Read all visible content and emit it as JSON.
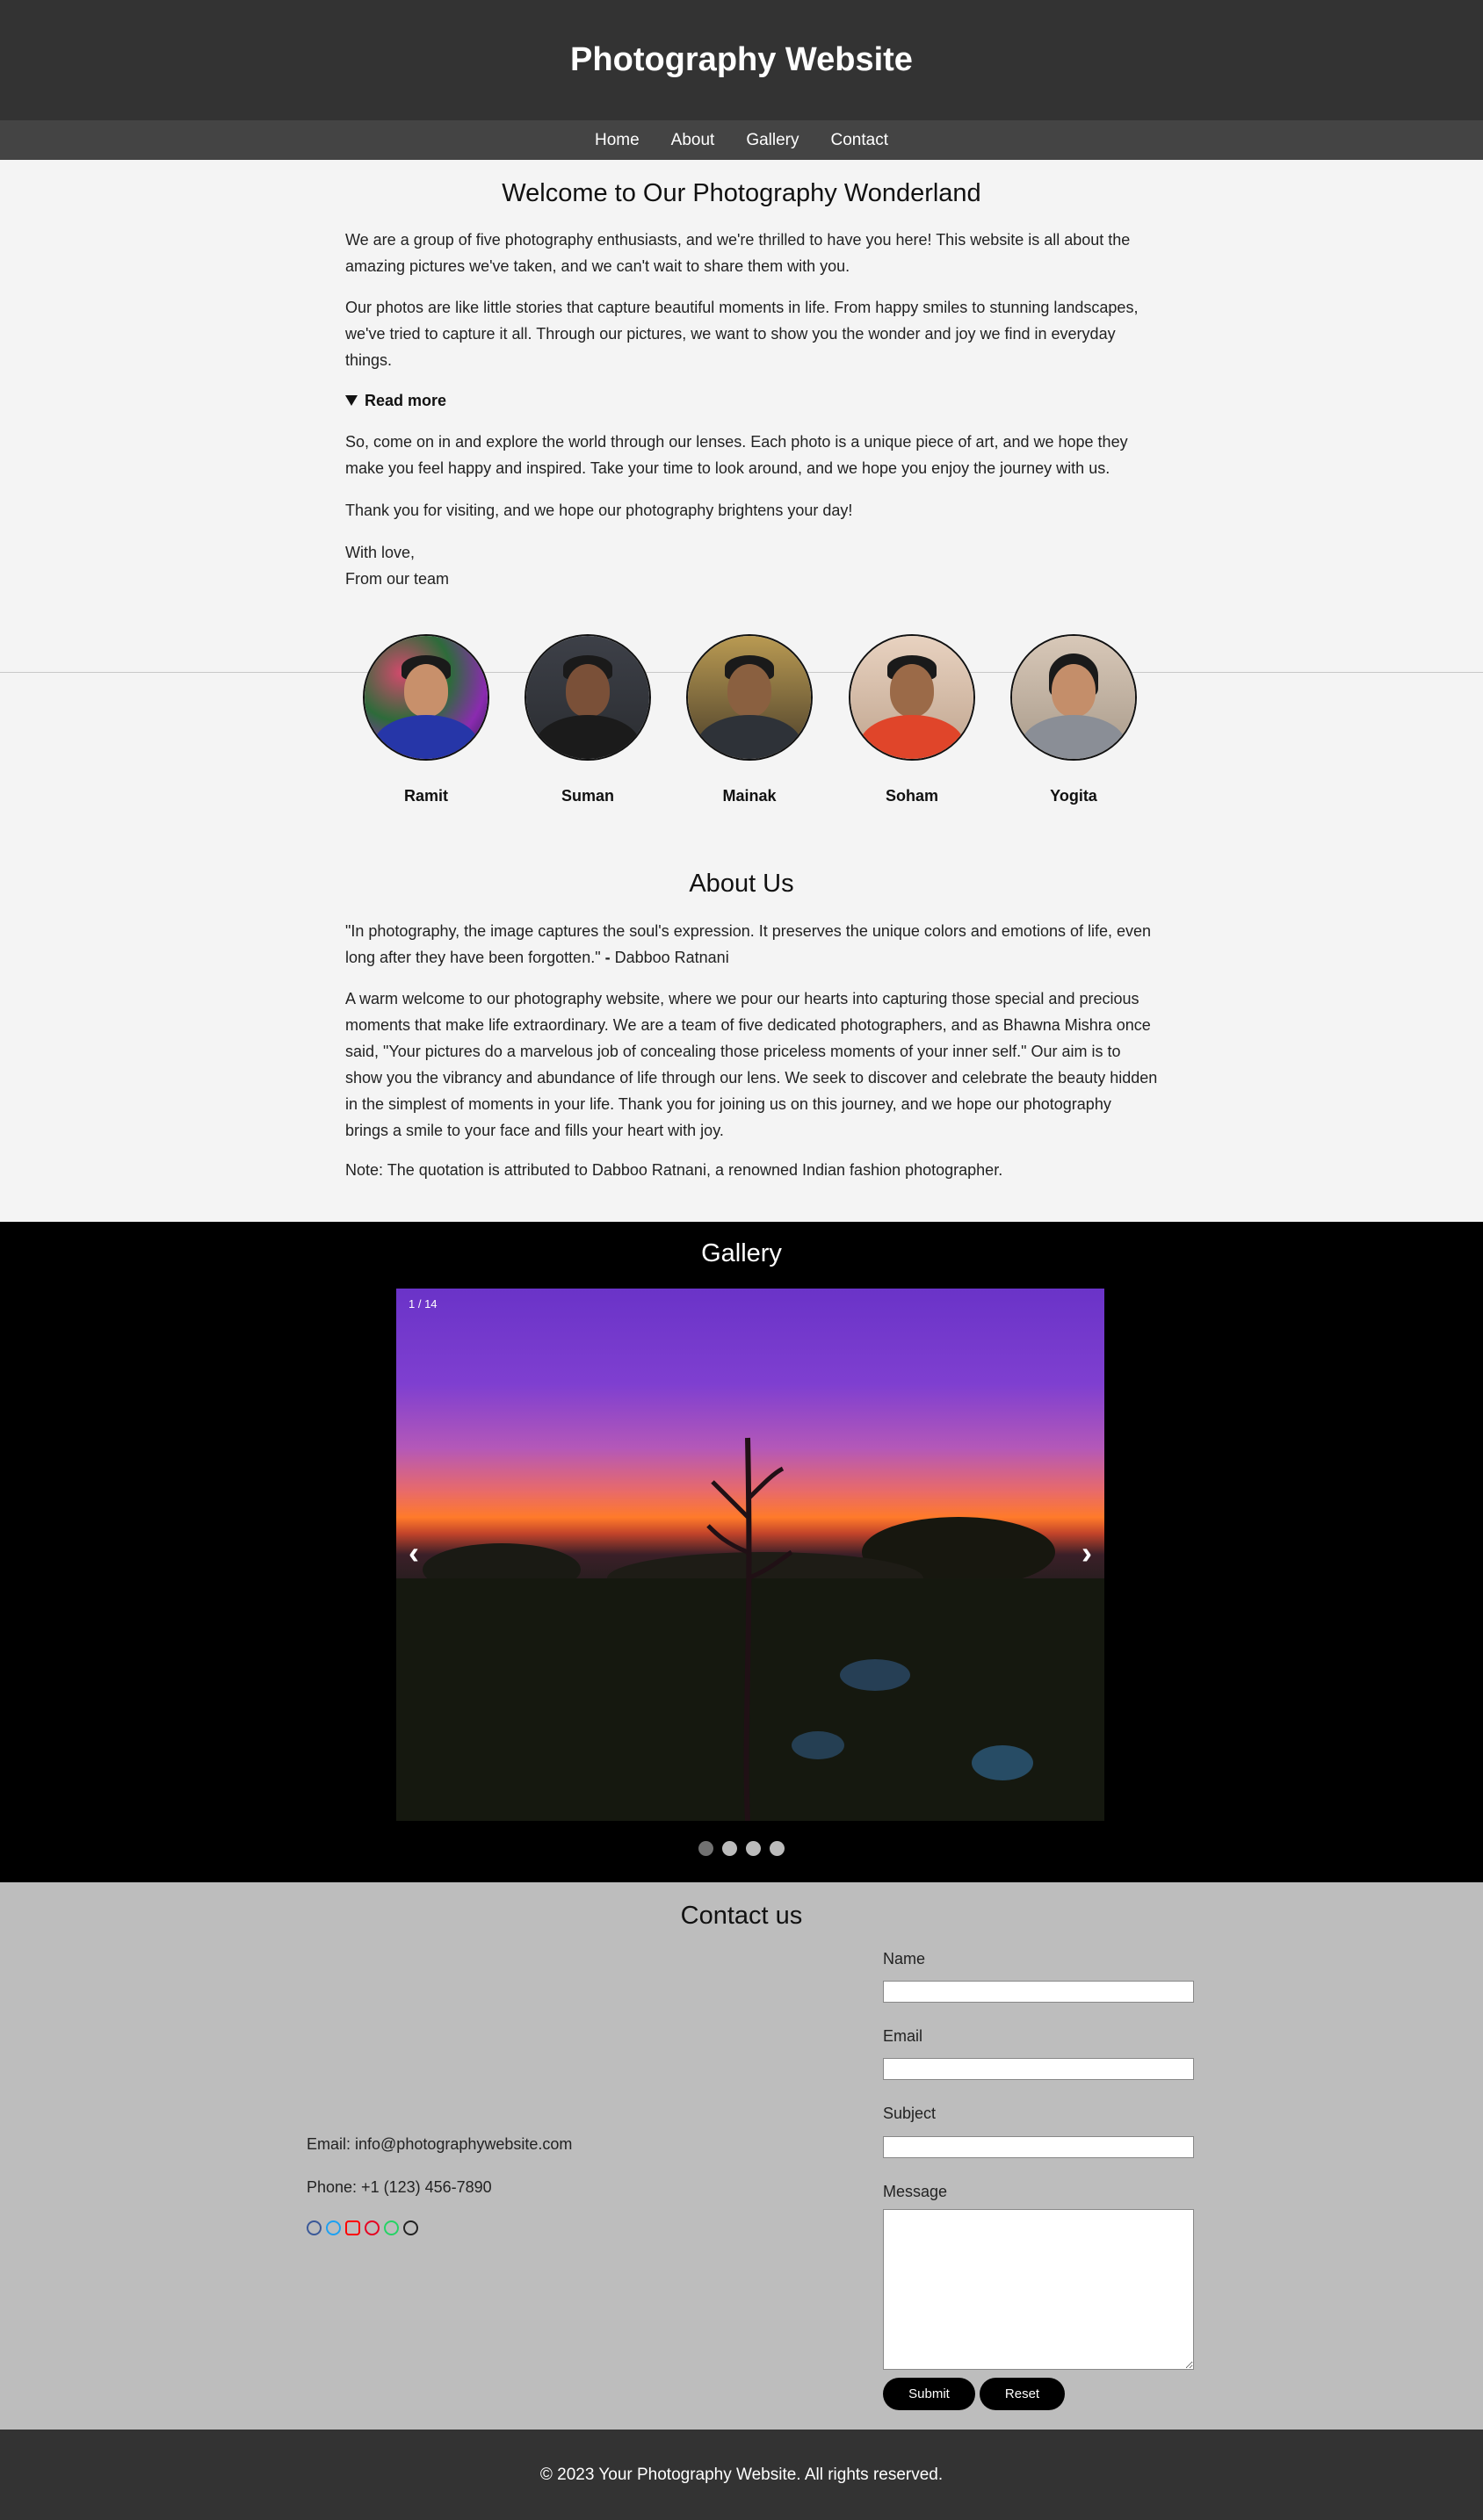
{
  "header": {
    "title": "Photography Website"
  },
  "nav": {
    "items": [
      "Home",
      "About",
      "Gallery",
      "Contact"
    ]
  },
  "welcome": {
    "title": "Welcome to Our Photography Wonderland",
    "p1": "We are a group of five photography enthusiasts, and we're thrilled to have you here! This website is all about the amazing pictures we've taken, and we can't wait to share them with you.",
    "p2": "Our photos are like little stories that capture beautiful moments in life. From happy smiles to stunning landscapes, we've tried to capture it all. Through our pictures, we want to show you the wonder and joy we find in everyday things.",
    "read_more": "Read more",
    "p3": "So, come on in and explore the world through our lenses. Each photo is a unique piece of art, and we hope they make you feel happy and inspired. Take your time to look around, and we hope you enjoy the journey with us.",
    "p4": "Thank you for visiting, and we hope our photography brightens your day!",
    "signoff_1": "With love,",
    "signoff_2": "From our team"
  },
  "team": [
    {
      "name": "Ramit"
    },
    {
      "name": "Suman"
    },
    {
      "name": "Mainak"
    },
    {
      "name": "Soham"
    },
    {
      "name": "Yogita"
    }
  ],
  "about": {
    "title": "About Us",
    "quote": "\"In photography, the image captures the soul's expression. It preserves the unique colors and emotions of life, even long after they have been forgotten.\"",
    "quote_sep": " - ",
    "quote_author": "Dabboo Ratnani",
    "p1": "A warm welcome to our photography website, where we pour our hearts into capturing those special and precious moments that make life extraordinary. We are a team of five dedicated photographers, and as Bhawna Mishra once said, \"Your pictures do a marvelous job of concealing those priceless moments of your inner self.\" Our aim is to show you the vibrancy and abundance of life through our lens. We seek to discover and celebrate the beauty hidden in the simplest of moments in your life. Thank you for joining us on this journey, and we hope our photography brings a smile to your face and fills your heart with joy.",
    "note": "Note: The quotation is attributed to Dabboo Ratnani, a renowned Indian fashion photographer."
  },
  "gallery": {
    "title": "Gallery",
    "counter": "1 / 14",
    "prev_arrow": "‹",
    "next_arrow": "›",
    "dot_count": 4,
    "active_dot": 0
  },
  "contact": {
    "title": "Contact us",
    "email": "Email: info@photographywebsite.com",
    "phone": "Phone: +1 (123) 456-7890",
    "socials": [
      {
        "icon": "facebook-icon",
        "color": "#3b5998"
      },
      {
        "icon": "twitter-icon",
        "color": "#1da1f2"
      },
      {
        "icon": "youtube-icon",
        "color": "#ff0000"
      },
      {
        "icon": "pinterest-icon",
        "color": "#e60023"
      },
      {
        "icon": "whatsapp-icon",
        "color": "#25d366"
      },
      {
        "icon": "github-icon",
        "color": "#222222"
      }
    ],
    "form": {
      "name_label": "Name",
      "email_label": "Email",
      "subject_label": "Subject",
      "message_label": "Message",
      "name_value": "",
      "email_value": "",
      "subject_value": "",
      "message_value": "",
      "submit_label": "Submit",
      "reset_label": "Reset"
    }
  },
  "footer": {
    "text": "© 2023 Your Photography Website. All rights reserved."
  },
  "colors": {
    "header_bg": "#333333",
    "nav_bg": "#444444",
    "page_bg": "#f4f4f4",
    "gallery_bg": "#000000",
    "contact_bg": "#bdbdbd"
  }
}
